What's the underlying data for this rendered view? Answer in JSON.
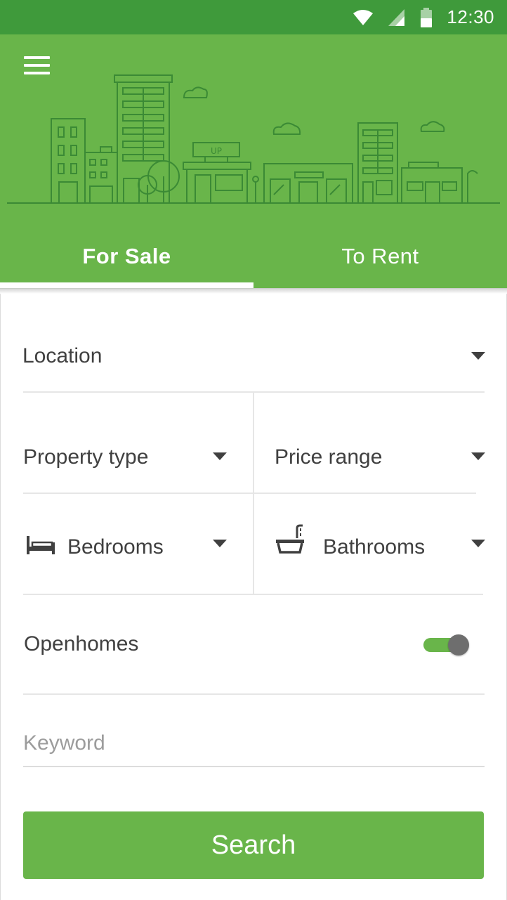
{
  "status_bar": {
    "time": "12:30",
    "icons": [
      "wifi-icon",
      "signal-icon",
      "battery-icon"
    ]
  },
  "header": {
    "menu_icon": "hamburger-menu-icon",
    "illustration": "city-skyline-illustration",
    "sign_text": "UP",
    "tabs": [
      {
        "label": "For Sale",
        "active": true
      },
      {
        "label": "To Rent",
        "active": false
      }
    ]
  },
  "form": {
    "location": {
      "label": "Location"
    },
    "property_type": {
      "label": "Property type"
    },
    "price_range": {
      "label": "Price range"
    },
    "bedrooms": {
      "label": "Bedrooms",
      "icon": "bed-icon"
    },
    "bathrooms": {
      "label": "Bathrooms",
      "icon": "bathtub-icon"
    },
    "openhomes": {
      "label": "Openhomes",
      "enabled": true
    },
    "keyword": {
      "placeholder": "Keyword",
      "value": ""
    },
    "search_label": "Search"
  },
  "colors": {
    "primary": "#69b54a",
    "status_bar": "#3f9a3b",
    "text": "#404040",
    "hint": "#9c9c9c",
    "divider": "#e6e6e6",
    "toggle_thumb": "#6e6e6e"
  }
}
